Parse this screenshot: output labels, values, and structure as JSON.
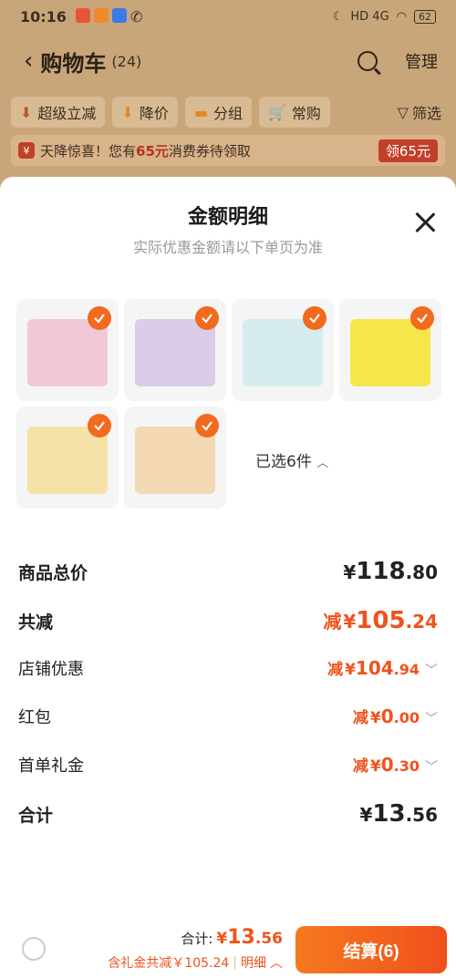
{
  "status": {
    "time": "10:16",
    "network": "HD 4G",
    "battery": "62"
  },
  "header": {
    "title": "购物车",
    "count": "(24)",
    "manage": "管理"
  },
  "filters": [
    {
      "label": "超级立减",
      "icon": "down-arrow-icon"
    },
    {
      "label": "降价",
      "icon": "down-arrow-icon"
    },
    {
      "label": "分组",
      "icon": "folder-icon"
    },
    {
      "label": "常购",
      "icon": "cart-icon"
    }
  ],
  "filter_end": "筛选",
  "coupon_banner": {
    "text_pre": "天降惊喜！您有",
    "amount": "65元",
    "text_post": "消费券待领取",
    "claim": "领65元"
  },
  "sheet": {
    "title": "金额明细",
    "subtitle": "实际优惠金额请以下单页为准",
    "selected": "已选6件",
    "products": [
      {
        "color": "#f1c8d6"
      },
      {
        "color": "#d9cde8"
      },
      {
        "color": "#d6ecef"
      },
      {
        "color": "#f7e64a"
      },
      {
        "color": "#f4e2a8"
      },
      {
        "color": "#f3d9b4"
      }
    ],
    "rows": [
      {
        "label": "商品总价",
        "bold": true,
        "prefix": "",
        "cur": "¥",
        "int": "118",
        "dec": ".80",
        "red": false,
        "chevron": false
      },
      {
        "label": "共减",
        "bold": true,
        "prefix": "减",
        "cur": "¥",
        "int": "105",
        "dec": ".24",
        "red": true,
        "chevron": false
      },
      {
        "label": "店铺优惠",
        "bold": false,
        "prefix": "减",
        "cur": "¥",
        "int": "104",
        "dec": ".94",
        "red": true,
        "chevron": true
      },
      {
        "label": "红包",
        "bold": false,
        "prefix": "减",
        "cur": "¥",
        "int": "0",
        "dec": ".00",
        "red": true,
        "chevron": true
      },
      {
        "label": "首单礼金",
        "bold": false,
        "prefix": "减",
        "cur": "¥",
        "int": "0",
        "dec": ".30",
        "red": true,
        "chevron": true
      },
      {
        "label": "合计",
        "bold": true,
        "prefix": "",
        "cur": "¥",
        "int": "13",
        "dec": ".56",
        "red": false,
        "chevron": false
      }
    ]
  },
  "bottom": {
    "total_label": "合计:",
    "total_cur": "¥",
    "total_int": "13",
    "total_dec": ".56",
    "gift_text": "含礼金共减￥105.24",
    "detail": "明细",
    "checkout": "结算(6)"
  }
}
